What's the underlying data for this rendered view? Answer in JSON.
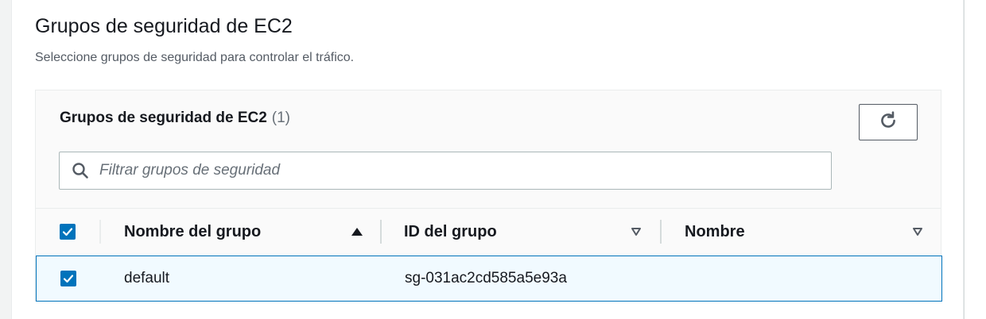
{
  "section": {
    "title": "Grupos de seguridad de EC2",
    "description": "Seleccione grupos de seguridad para controlar el tráfico."
  },
  "table": {
    "heading": "Grupos de seguridad de EC2",
    "count": "(1)",
    "refresh_icon": "refresh-icon",
    "search": {
      "placeholder": "Filtrar grupos de seguridad",
      "value": "",
      "icon": "search-icon"
    },
    "select_all_checked": true,
    "columns": [
      {
        "label": "Nombre del grupo",
        "sort": "ascending",
        "sort_icon": "caret-up-filled-icon"
      },
      {
        "label": "ID del grupo",
        "sort": "none",
        "sort_icon": "caret-down-outline-icon"
      },
      {
        "label": "Nombre",
        "sort": "none",
        "sort_icon": "caret-down-outline-icon"
      }
    ],
    "rows": [
      {
        "checked": true,
        "group_name": "default",
        "group_id": "sg-031ac2cd585a5e93a",
        "name": ""
      }
    ]
  },
  "colors": {
    "accent": "#0073bb",
    "selected_row_bg": "#f1faff",
    "text": "#16191f",
    "muted_text": "#545b64"
  }
}
